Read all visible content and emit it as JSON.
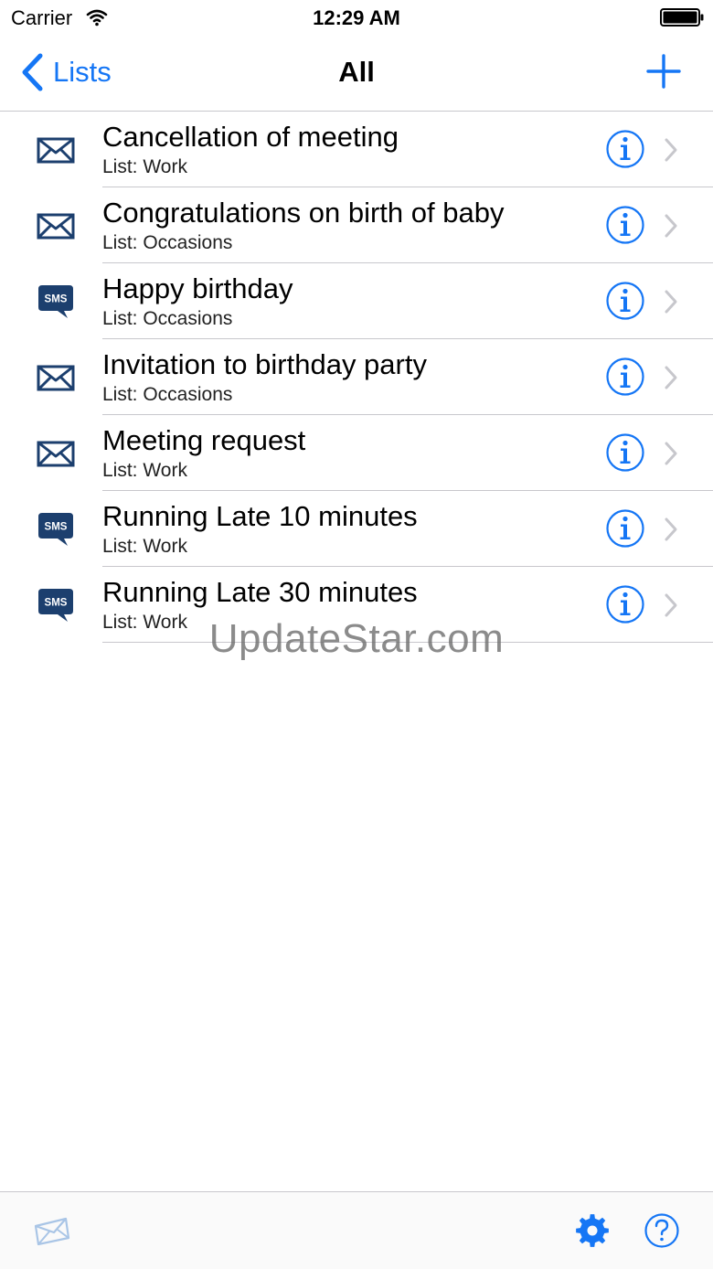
{
  "status_bar": {
    "carrier": "Carrier",
    "time": "12:29 AM"
  },
  "nav": {
    "back_label": "Lists",
    "title": "All"
  },
  "items": [
    {
      "title": "Cancellation of meeting",
      "subtitle": "List: Work",
      "icon": "envelope-icon"
    },
    {
      "title": "Congratulations on birth of baby",
      "subtitle": "List: Occasions",
      "icon": "envelope-icon"
    },
    {
      "title": "Happy birthday",
      "subtitle": "List: Occasions",
      "icon": "sms-icon",
      "badge": "SMS"
    },
    {
      "title": "Invitation to birthday party",
      "subtitle": "List: Occasions",
      "icon": "envelope-icon"
    },
    {
      "title": "Meeting request",
      "subtitle": "List: Work",
      "icon": "envelope-icon"
    },
    {
      "title": "Running Late 10 minutes",
      "subtitle": "List: Work",
      "icon": "sms-icon",
      "badge": "SMS"
    },
    {
      "title": "Running Late 30 minutes",
      "subtitle": "List: Work",
      "icon": "sms-icon",
      "badge": "SMS"
    }
  ],
  "watermark": "UpdateStar.com",
  "colors": {
    "accent": "#1576f5",
    "icon_navy": "#1c3f6e",
    "separator": "#c8c7cc",
    "chevron": "#c7c7cc"
  }
}
